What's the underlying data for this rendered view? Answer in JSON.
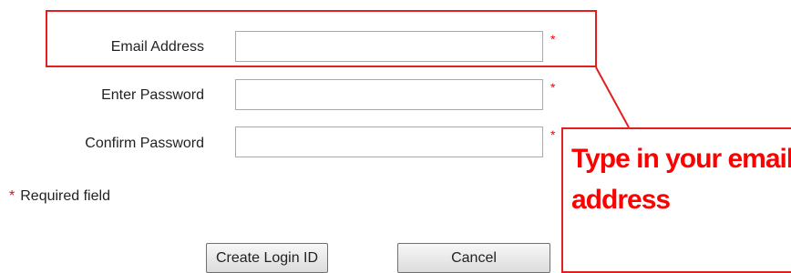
{
  "form": {
    "email": {
      "label": "Email Address",
      "value": "",
      "required_marker": "*"
    },
    "password": {
      "label": "Enter Password",
      "value": "",
      "required_marker": "*"
    },
    "confirm_password": {
      "label": "Confirm Password",
      "value": "",
      "required_marker": "*"
    },
    "required_note": {
      "marker": "*",
      "text": "Required field"
    },
    "buttons": {
      "create": "Create Login ID",
      "cancel": "Cancel"
    }
  },
  "annotation": {
    "callout_text": "Type in your email address",
    "color": "#ff0000"
  }
}
